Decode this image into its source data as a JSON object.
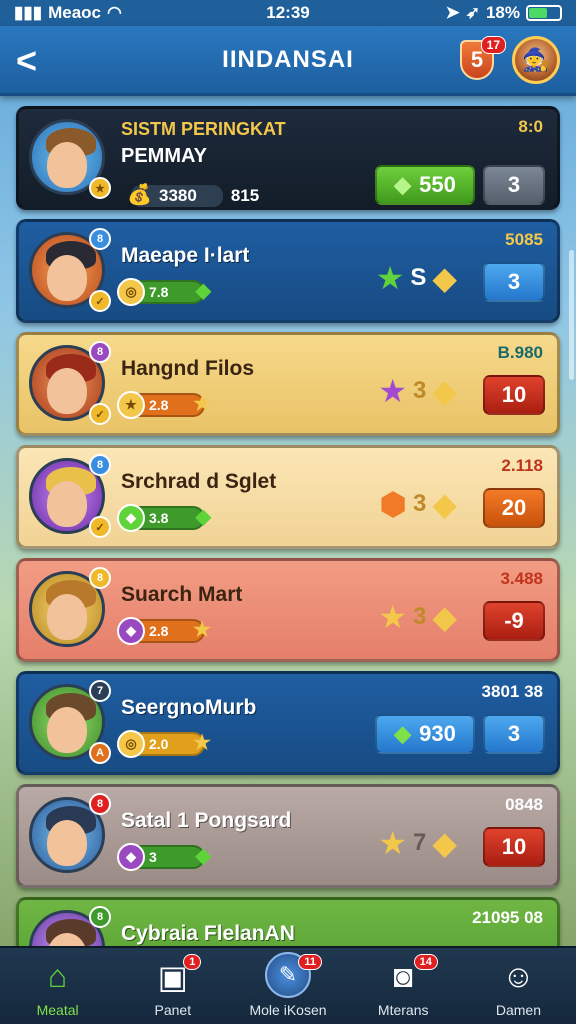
{
  "status_bar": {
    "carrier": "Meaoc",
    "time": "12:39",
    "battery": "18%",
    "icons": [
      "signal-icon",
      "wifi-icon",
      "location-icon",
      "battery-icon"
    ]
  },
  "header": {
    "title": "IINDANSAI",
    "badge_level": "5",
    "badge_notif": "17"
  },
  "first_card": {
    "title_line1": "SISTM PERINGKAT",
    "title_line2": "PEMMAY",
    "rank": "8:0",
    "coins": "3380",
    "coins_extra": "815",
    "cost": "550",
    "value": "3"
  },
  "cards": [
    {
      "name": "Maeape I·lart",
      "rank": "5085",
      "level": "7.8",
      "mult": "S",
      "value": "3",
      "style": "blue",
      "button": "blue",
      "star1": "green-star",
      "star2": "gold-gem",
      "av_corner": "8"
    },
    {
      "name": "Hangnd Filos",
      "rank": "B.980",
      "level": "2.8",
      "mult": "3",
      "value": "10",
      "style": "yellow",
      "button": "red",
      "star1": "purple-star",
      "star2": "gold-gem",
      "av_corner": "8"
    },
    {
      "name": "Srchrad d Sglet",
      "rank": "2.118",
      "level": "3.8",
      "mult": "3",
      "value": "20",
      "style": "cream",
      "button": "orange",
      "star1": "orange-gem",
      "star2": "gold-gem",
      "av_corner": "8"
    },
    {
      "name": "Suarch Mart",
      "rank": "3.488",
      "level": "2.8",
      "mult": "3",
      "value": "-9",
      "style": "salmon",
      "button": "red",
      "star1": "gold-star",
      "star2": "gold-gem",
      "av_corner": "8"
    },
    {
      "name": "SeergnoMurb",
      "rank": "3801 38",
      "level": "2.0",
      "cost": "930",
      "value": "3",
      "style": "blue",
      "button": "blue",
      "av_corner": "7"
    },
    {
      "name": "Satal 1 Pongsard",
      "rank": "0848",
      "level": "3",
      "mult": "7",
      "value": "10",
      "style": "gray",
      "button": "red",
      "star1": "gold-star",
      "star2": "gold-gem",
      "av_corner": "8"
    },
    {
      "name": "Cybraia FlelanAN",
      "rank": "21095 08",
      "style": "green",
      "av_corner": "8"
    }
  ],
  "bottom_nav": [
    {
      "label": "Meatal",
      "icon": "home-icon"
    },
    {
      "label": "Panet",
      "icon": "grid-icon",
      "notif": "1"
    },
    {
      "label": "Mole iKosen",
      "icon": "center-icon",
      "notif": "11"
    },
    {
      "label": "Mterans",
      "icon": "camera-icon",
      "notif": "14"
    },
    {
      "label": "Damen",
      "icon": "profile-icon"
    }
  ]
}
